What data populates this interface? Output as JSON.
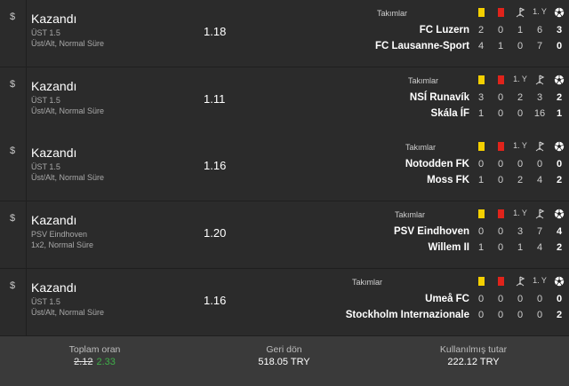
{
  "icons": {
    "currency": "dollar-icon",
    "yellow_card": "yellow-card-icon",
    "red_card": "red-card-icon",
    "corner": "corner-flag-icon",
    "goal": "football-icon"
  },
  "colors": {
    "yellow_card": "#f4d000",
    "red_card": "#e0231b",
    "new_odds": "#3fae49"
  },
  "bets": [
    {
      "currency": "$",
      "status": "Kazandı",
      "selection": "ÜST 1.5",
      "market": "Üst/Alt, Normal Süre",
      "odds": "1.18",
      "stats": {
        "label": "Takımlar",
        "col_labels": [
          "",
          "",
          "",
          "1. Y"
        ],
        "teams": [
          {
            "name": "FC Luzern",
            "values": [
              "2",
              "0",
              "1",
              "6",
              "3"
            ]
          },
          {
            "name": "FC Lausanne-Sport",
            "values": [
              "4",
              "1",
              "0",
              "7",
              "0"
            ]
          }
        ]
      }
    },
    {
      "currency": "$",
      "status": "Kazandı",
      "selection": "ÜST 1.5",
      "market": "Üst/Alt, Normal Süre",
      "odds": "1.11",
      "stats": {
        "label": "Takımlar",
        "col_labels": [
          "",
          "",
          "1. Y",
          ""
        ],
        "teams": [
          {
            "name": "NSÍ Runavík",
            "values": [
              "3",
              "0",
              "2",
              "3",
              "2"
            ]
          },
          {
            "name": "Skála ÍF",
            "values": [
              "1",
              "0",
              "0",
              "16",
              "1"
            ]
          }
        ]
      }
    },
    {
      "currency": "$",
      "status": "Kazandı",
      "selection": "ÜST 1.5",
      "market": "Üst/Alt, Normal Süre",
      "odds": "1.16",
      "stats": {
        "label": "Takımlar",
        "col_labels": [
          "",
          "",
          "1. Y",
          ""
        ],
        "teams": [
          {
            "name": "Notodden FK",
            "values": [
              "0",
              "0",
              "0",
              "0",
              "0"
            ]
          },
          {
            "name": "Moss FK",
            "values": [
              "1",
              "0",
              "2",
              "4",
              "2"
            ]
          }
        ]
      }
    },
    {
      "currency": "$",
      "status": "Kazandı",
      "selection": "PSV Eindhoven",
      "market": "1x2, Normal Süre",
      "odds": "1.20",
      "stats": {
        "label": "Takımlar",
        "col_labels": [
          "",
          "",
          "1. Y",
          ""
        ],
        "teams": [
          {
            "name": "PSV Eindhoven",
            "values": [
              "0",
              "0",
              "3",
              "7",
              "4"
            ]
          },
          {
            "name": "Willem II",
            "values": [
              "1",
              "0",
              "1",
              "4",
              "2"
            ]
          }
        ]
      }
    },
    {
      "currency": "$",
      "status": "Kazandı",
      "selection": "ÜST 1.5",
      "market": "Üst/Alt, Normal Süre",
      "odds": "1.16",
      "stats": {
        "label": "Takımlar",
        "col_labels": [
          "",
          "",
          "",
          "1. Y"
        ],
        "teams": [
          {
            "name": "Umeå FC",
            "values": [
              "0",
              "0",
              "0",
              "0",
              "0"
            ]
          },
          {
            "name": "Stockholm Internazionale",
            "values": [
              "0",
              "0",
              "0",
              "0",
              "2"
            ]
          }
        ]
      }
    }
  ],
  "footer": {
    "total_odds_label": "Toplam oran",
    "total_odds_old": "2.12",
    "total_odds_new": "2.33",
    "return_label": "Geri dön",
    "return_value": "518.05 TRY",
    "stake_label": "Kullanılmış tutar",
    "stake_value": "222.12 TRY"
  }
}
